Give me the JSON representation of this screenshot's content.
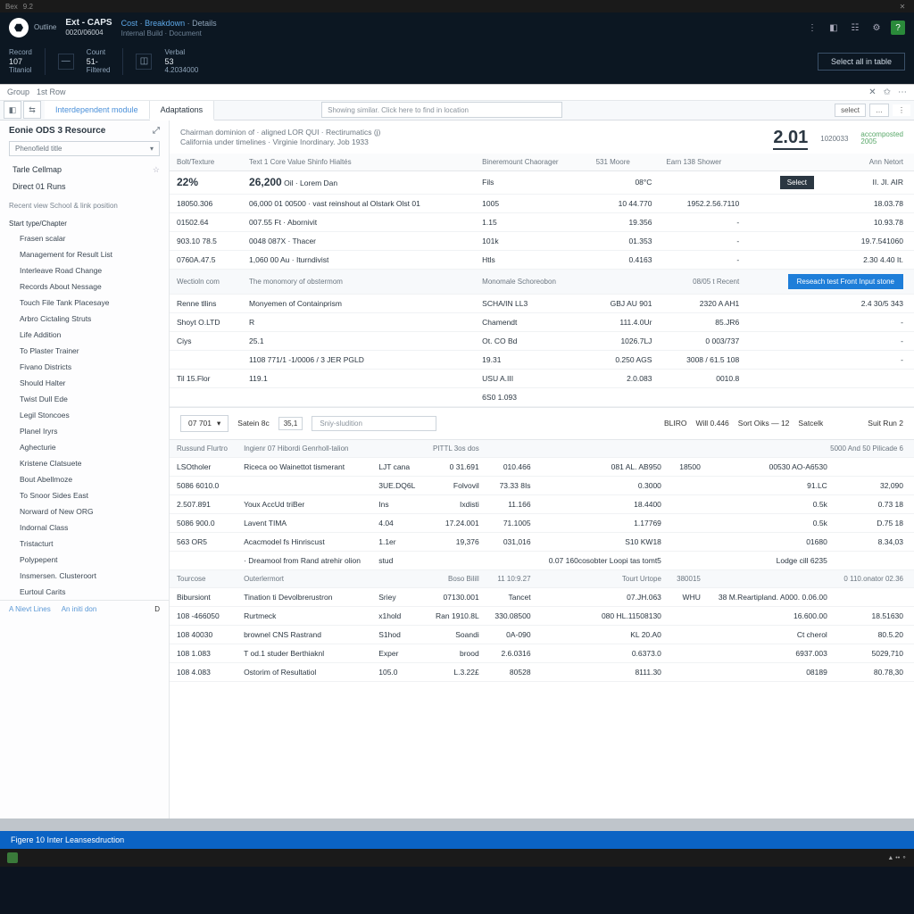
{
  "titlebar": {
    "app": "Bex",
    "sub": "9.2",
    "close": "✕"
  },
  "header": {
    "brand": {
      "icon": "⬣",
      "line": "Outline"
    },
    "project": {
      "name": "Ext - CAPS",
      "code": "0020/06004"
    },
    "crumbs": {
      "a": "Cost",
      "b": "Breakdown",
      "c": "Details"
    },
    "sub_crumb": "Internal Build · Document",
    "icons": {
      "i1": "⋮",
      "i2": "◧",
      "i3": "☷",
      "i4": "⚙",
      "badge": "?"
    },
    "stats": [
      {
        "lbl": "Record",
        "val": "107",
        "sub": "Titaniol"
      },
      {
        "lbl": "Count",
        "val": "51-",
        "sub": "Filtered",
        "icon": "◫"
      },
      {
        "lbl": "Verbal",
        "val": "53",
        "sub": "4.2034000"
      }
    ],
    "ghost_btn": "Select all in table"
  },
  "crumbs_light": {
    "a": "Group",
    "b": "1st Row",
    "x": "✕"
  },
  "tabs": {
    "left_btns": [
      "◧",
      "⇆"
    ],
    "items": [
      "Interdependent module",
      "Adaptations"
    ],
    "search_ph": "Showing similar. Click here to find in location",
    "right": [
      "select",
      "…",
      "⋮"
    ]
  },
  "sidebar": {
    "title": "Eonie ODS 3 Resource",
    "dd": "Phenofield title",
    "top_items": [
      {
        "label": "Tarle Cellmap",
        "fav": true
      },
      {
        "label": "Direct 01 Runs"
      }
    ],
    "hint": "Recent view School & link position",
    "group1_label": "Start type/Chapter",
    "group1": [
      "Frasen scalar",
      "Management for Result List",
      "Interleave Road Change",
      "Records About Nessage",
      "Touch File Tank Placesaye",
      "Arbro Cictaling Struts",
      "Life Addition",
      "To Plaster Trainer",
      "Fivano Districts",
      "Should Halter",
      "Twist Dull Ede",
      "Legil Stoncoes",
      "Planel Iryrs",
      "Aghecturie",
      "Kristene Clatsuete",
      "Bout Abellmoze",
      "To Snoor Sides East",
      "Norward of New ORG",
      "Indornal Class",
      "Tristacturt",
      "Polypepent",
      "Insmersen. Clusteroort",
      "Eurtoul Carits"
    ],
    "footer": {
      "a": "A Nievt Lines",
      "b": "An initi don",
      "c": "D"
    }
  },
  "overview": {
    "line1": "Chairman dominion of · aligned LOR QUI · Rectirumatics (j)",
    "line2": "California under timelines · Virginie Inordinary. Job 1933",
    "kpi": "2.01",
    "kpi_lbl": "1020033",
    "kpi_sub1": "accomposted",
    "kpi_sub2": "2005"
  },
  "table1": {
    "headers": [
      "Bolt/Texture",
      "Text 1 Core Value Shinfo Hialtés",
      "Bineremount Chaorager",
      "531 Moore",
      "Earn 138 Shower",
      "",
      "Ann Netort"
    ],
    "row_hl": {
      "a": "22%",
      "b": "26,200",
      "b2": "Oil · Lorem Dan",
      "c": "Fils",
      "d": "08°C",
      "e": "",
      "btn": "Select",
      "f": "II. JI. AIR"
    },
    "rows": [
      [
        "18050.306",
        "06,000 01 00500 · vast reinshout al Olstark Olst 01",
        "1005",
        "10 44.770",
        "1952.2.56.7110",
        "",
        "18.03.78"
      ],
      [
        "01502.64",
        "007.55 Ft · Abornivit",
        "1.15",
        "19.356",
        "-",
        "",
        "10.93.78"
      ],
      [
        "903.10 78.5",
        "0048 087X · Thacer",
        "101k",
        "01.353",
        "-",
        "",
        "19.7.541060"
      ],
      [
        "0760A.47.5",
        "1,060 00 Au · Iturndivist",
        "Htls",
        "0.4163",
        "-",
        "",
        "2.30 4.40 It."
      ]
    ],
    "section": {
      "a": "Wectioln com",
      "b": "The monomory of obstermom",
      "c": "Monomale Schoreobon",
      "d": "08/05 t Recent",
      "btn": "Reseach test Front Input stone"
    },
    "rows2": [
      [
        "Renne tllins",
        "Monyemen of Containprism",
        "SCHA/IN LL3",
        "GBJ AU 901",
        "2320 A AH1",
        "",
        "2.4 30/5 343"
      ],
      [
        "Shoyt O.LTD",
        "R",
        "Chamendt",
        "111.4.0Ur",
        "85.JR6",
        "",
        "-"
      ],
      [
        "Ciys",
        "25.1",
        "Ot. CO Bd",
        "1026.7LJ",
        "0 003/737",
        "",
        "-"
      ],
      [
        "",
        "1108 771/1 -1/0006 / 3 JER PGLD",
        "19.31",
        "0.250 AGS",
        "3008 / 61.5 108",
        "",
        "-"
      ],
      [
        "Til 15.Flor",
        "119.1",
        "USU A.III",
        "2.0.083",
        "0010.8",
        "",
        ""
      ],
      [
        "",
        "",
        "6S0 1.093",
        "",
        "",
        "",
        ""
      ]
    ]
  },
  "filter": {
    "dd1": "07 701",
    "lbl": "Satein 8c",
    "dd2": "35,1",
    "search": "Sniy-sludition",
    "cols": [
      "BLIRO",
      "Will 0.446",
      "Sort Oiks — 12",
      "Satcelk",
      "",
      "Suit Run 2"
    ]
  },
  "table2": {
    "section": {
      "a": "Russund Flurtro",
      "b": "Ingienr 07 Hibordi Genrholl-talion",
      "c": "PITTL 3os dos",
      "d": "",
      "e": "5000 And 50 Pilicade 6"
    },
    "rows": [
      [
        "LSOtholer",
        "Riceca oo Wainettot tismerant",
        "LJT cana",
        "0 31.691",
        "010.466",
        "081 AL. AB950",
        "18500",
        "00530 AO-A6530"
      ],
      [
        "5086 6010.0",
        "",
        "3UE.DQ6L",
        "Folvovil",
        "73.33 8Is",
        "0.3000",
        "",
        "91.LC",
        "32,090"
      ],
      [
        "2.507.891",
        "Youx AccUd triBer",
        "Ins",
        "Ixdisti",
        "11.166",
        "18.4400",
        "",
        "0.5k",
        "0.73 18"
      ],
      [
        "5086 900.0",
        "Lavent TIMA",
        "4.04",
        "17.24.001",
        "71.1005",
        "1.17769",
        "",
        "0.5k",
        "D.75 18"
      ],
      [
        "563 OR5",
        "Acacmodel fs Hinriscust",
        "1.1er",
        "19,376",
        "031,016",
        "S10 KW18",
        "",
        "01680",
        "8.34,03"
      ],
      [
        "",
        "· Dreamool from Rand atrehir olion",
        "stud",
        "",
        "",
        "0.07 160cosobter Loopi tas tomt5",
        "",
        "Lodge cill 6235"
      ]
    ],
    "rows2_hdr": [
      "Tourcose",
      "Outerlermort",
      "",
      "Boso Bilill",
      "11 10:9.27",
      "Tourt Urtope",
      "380015",
      "",
      "0 110.onator 02.36"
    ],
    "rows2": [
      [
        "Bibursiont",
        "Tination ti Devolbrerustron",
        "Sriey",
        "07130.001",
        "Tancet",
        "07.JH.063",
        "WHU",
        "38 M.Reartipland. A000. 0.06.00"
      ],
      [
        "108 -466050",
        "Rurtmeck",
        "x1hold",
        "Ran 1910.8L",
        "330.08500",
        "080 HL.11508130",
        "",
        "16.600.00",
        "18.51630"
      ],
      [
        "108 40030",
        "brownel CNS Rastrand",
        "S1hod",
        "Soandi",
        "0A-090",
        "KL 20.A0",
        "",
        "Ct cherol",
        "80.5.20"
      ],
      [
        "108 1.083",
        "T od.1 studer Berthiaknl",
        "Exper",
        "brood",
        "2.6.0316",
        "0.6373.0",
        "",
        "6937.003",
        "5029,710"
      ],
      [
        "108 4.083",
        "Ostorim of Resultatiol",
        "105.0",
        "L.3.22£",
        "80528",
        "8111.30",
        "",
        "08189",
        "80.78,30"
      ]
    ]
  },
  "status": "Figere 10 Inter Leansesdruction",
  "sys_tray": "▲ •• ⚬"
}
